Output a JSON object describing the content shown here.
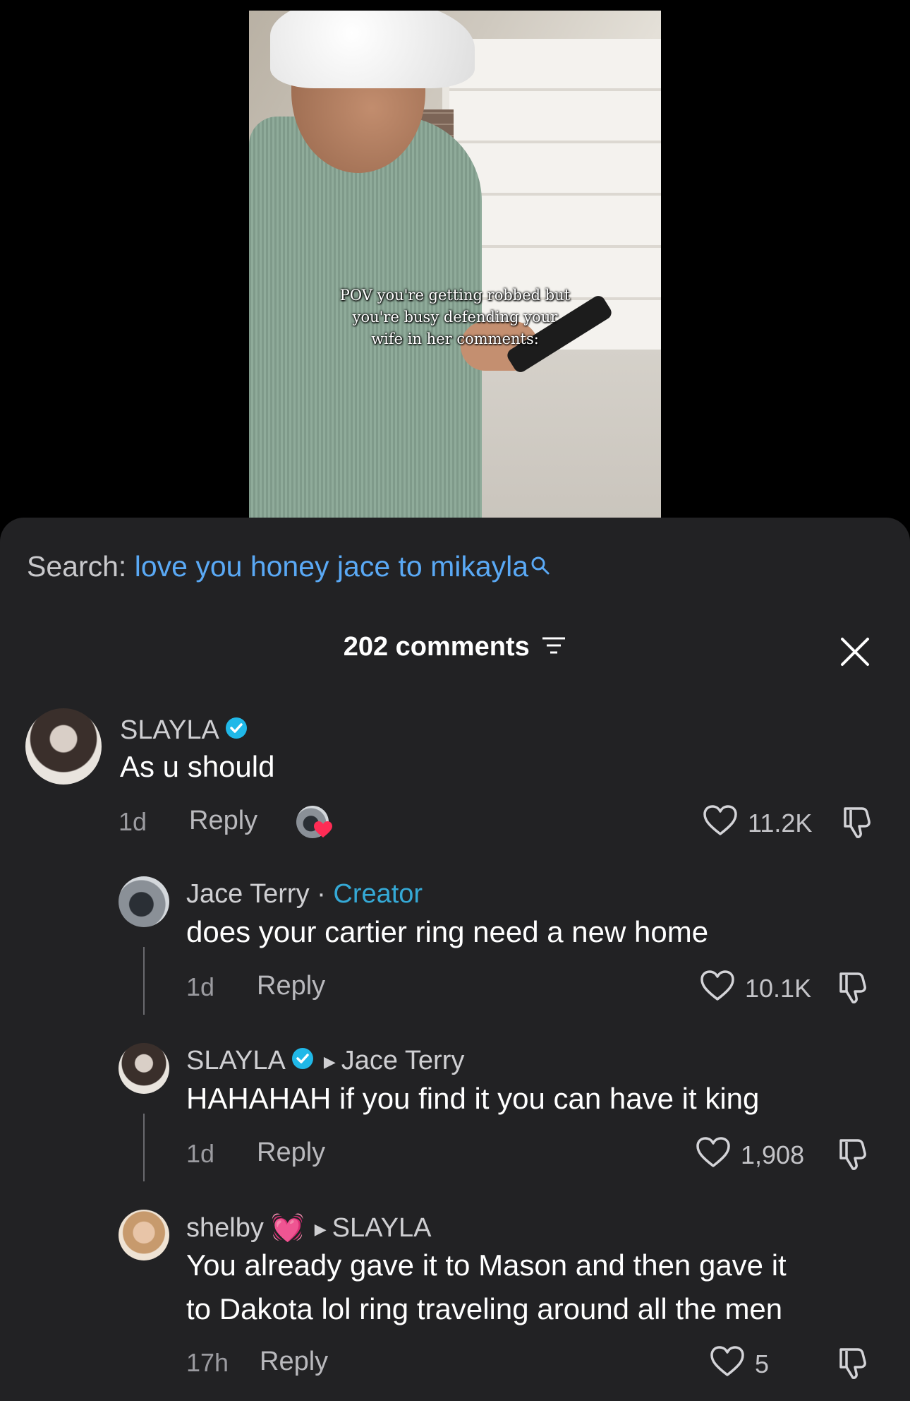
{
  "video": {
    "caption": [
      "POV you're getting robbed but",
      "you're busy defending your",
      "wife in her comments:"
    ]
  },
  "search": {
    "label": "Search:",
    "query": "love you honey jace to mikayla"
  },
  "header": {
    "count_label": "202 comments"
  },
  "comments": [
    {
      "user": "SLAYLA",
      "verified": true,
      "text": "As u should",
      "time": "1d",
      "reply": "Reply",
      "likes": "11.2K",
      "creator_liked": true
    },
    {
      "user": "Jace Terry",
      "sep": "·",
      "role": "Creator",
      "text": "does your cartier ring need a new home",
      "time": "1d",
      "reply": "Reply",
      "likes": "10.1K"
    },
    {
      "user": "SLAYLA",
      "verified": true,
      "reply_to": "Jace Terry",
      "text": "HAHAHAH if you find it you can have it king",
      "time": "1d",
      "reply": "Reply",
      "likes": "1,908"
    },
    {
      "user": "shelby",
      "emoji": "💓",
      "reply_to": "SLAYLA",
      "text_line1": "You already gave it to Mason and then gave it",
      "text_line2": "to Dakota lol ring traveling around all the men",
      "time": "17h",
      "reply": "Reply",
      "likes": "5"
    }
  ],
  "colors": {
    "sheet_bg": "#222224",
    "search_query": "#5aa9f5",
    "creator": "#35a9d6",
    "verified": "#20b8e8",
    "heart_red": "#fe2c55"
  }
}
